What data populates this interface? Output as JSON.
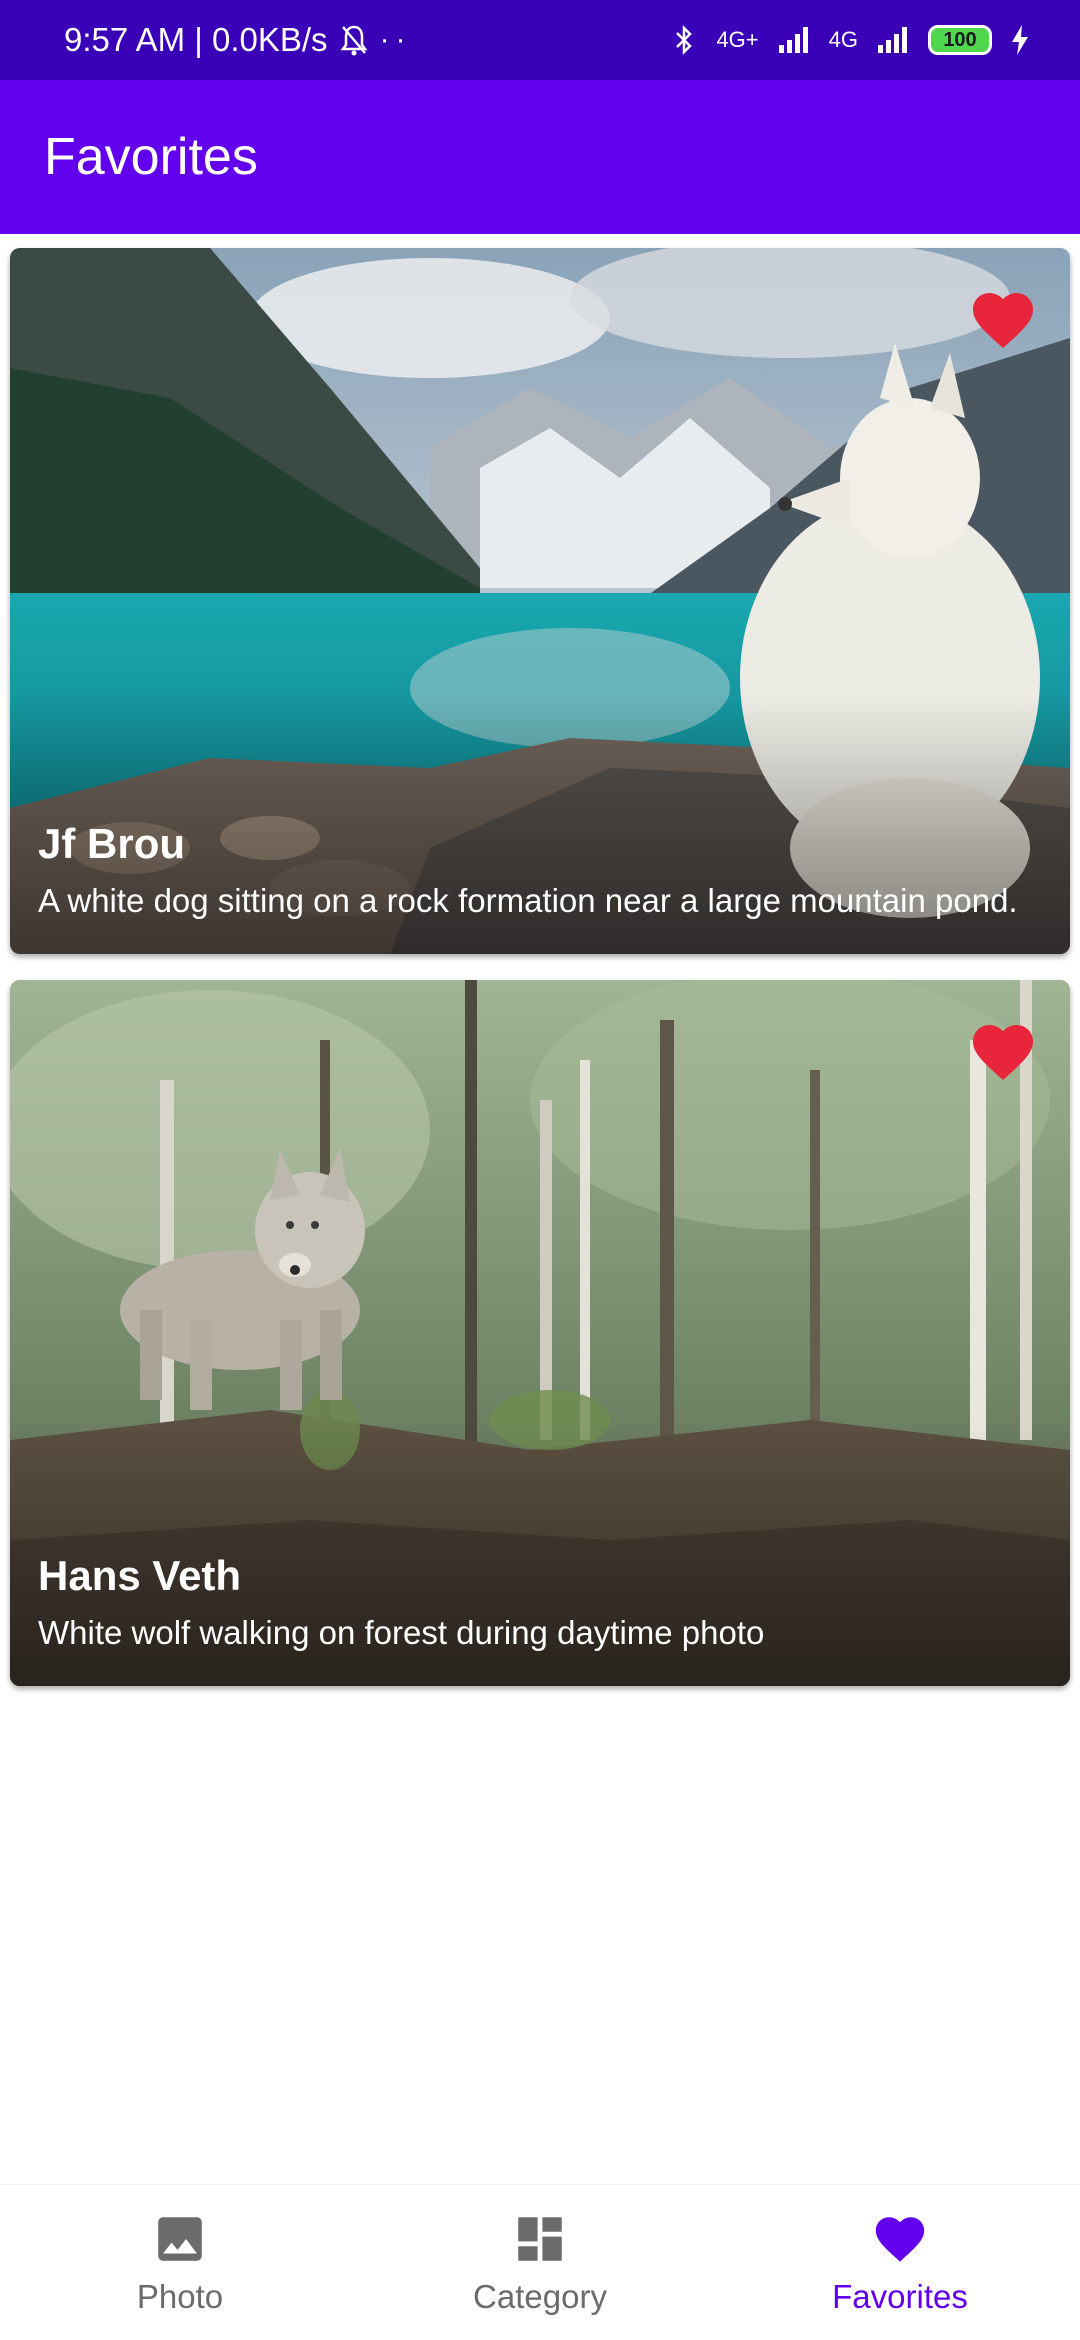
{
  "status_bar": {
    "time": "9:57 AM | 0.0KB/s",
    "dots": "··",
    "network_1": "4G+",
    "network_2": "4G",
    "battery": "100"
  },
  "app_bar": {
    "title": "Favorites"
  },
  "cards": [
    {
      "author": "Jf Brou",
      "description": "A white dog sitting on a rock formation near a large mountain pond.",
      "favorite": true
    },
    {
      "author": "Hans Veth",
      "description": "White wolf walking on forest during daytime photo",
      "favorite": true
    }
  ],
  "bottom_nav": {
    "items": [
      {
        "label": "Photo",
        "icon": "image-icon",
        "active": false
      },
      {
        "label": "Category",
        "icon": "dashboard-icon",
        "active": false
      },
      {
        "label": "Favorites",
        "icon": "heart-icon",
        "active": true
      }
    ]
  },
  "colors": {
    "status_bar": "#3a00b8",
    "app_bar": "#6200ee",
    "accent": "#6200ee",
    "favorite_heart": "#e8253a",
    "inactive": "#6b6b6b"
  }
}
